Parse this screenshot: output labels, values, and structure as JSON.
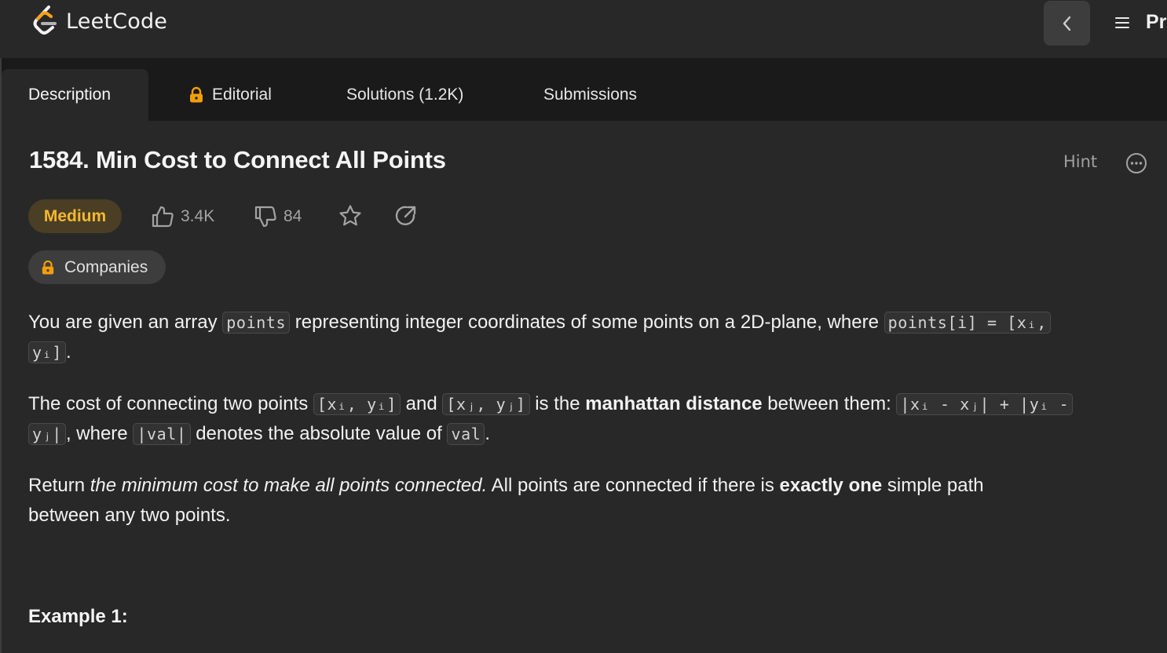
{
  "app": {
    "logo_text": "LeetCode",
    "nav_label": "Pr"
  },
  "tabs": [
    {
      "label": "Description",
      "active": true
    },
    {
      "label": "Editorial",
      "locked": true
    },
    {
      "label": "Solutions (1.2K)"
    },
    {
      "label": "Submissions"
    }
  ],
  "problem": {
    "title": "1584. Min Cost to Connect All Points",
    "hint_label": "Hint",
    "difficulty": "Medium",
    "likes": "3.4K",
    "dislikes": "84",
    "companies_label": "Companies"
  },
  "description": {
    "p1": {
      "t1": "You are given an array ",
      "c1": "points",
      "t2": " representing integer coordinates of some points on a 2D-plane, where ",
      "c2": "points[i] = [xᵢ,",
      "c3": "yᵢ]",
      "t3": "."
    },
    "p2": {
      "t1": "The cost of connecting two points ",
      "c1": "[xᵢ, yᵢ]",
      "t2": " and ",
      "c2": "[xⱼ, yⱼ]",
      "t3": " is the ",
      "b1": "manhattan distance",
      "t4": " between them: ",
      "c3": "|xᵢ - xⱼ| + |yᵢ -",
      "c4": "yⱼ|",
      "t5": ", where ",
      "c5": "|val|",
      "t6": " denotes the absolute value of ",
      "c6": "val",
      "t7": "."
    },
    "p3": {
      "t1": "Return ",
      "i1": "the minimum cost to make all points connected.",
      "t2": " All points are connected if there is ",
      "b1": "exactly one",
      "t3": " simple path",
      "line2": "between any two points."
    },
    "example_heading": "Example 1:"
  },
  "colors": {
    "background": "#282828",
    "tabstrip": "#1a1a1a",
    "medium": "#f7b731",
    "lock": "#f59e0b"
  },
  "icons": [
    "leetcode-logo-icon",
    "chevron-left-icon",
    "menu-icon",
    "lock-icon",
    "thumbs-up-icon",
    "thumbs-down-icon",
    "star-icon",
    "share-icon",
    "more-icon"
  ]
}
